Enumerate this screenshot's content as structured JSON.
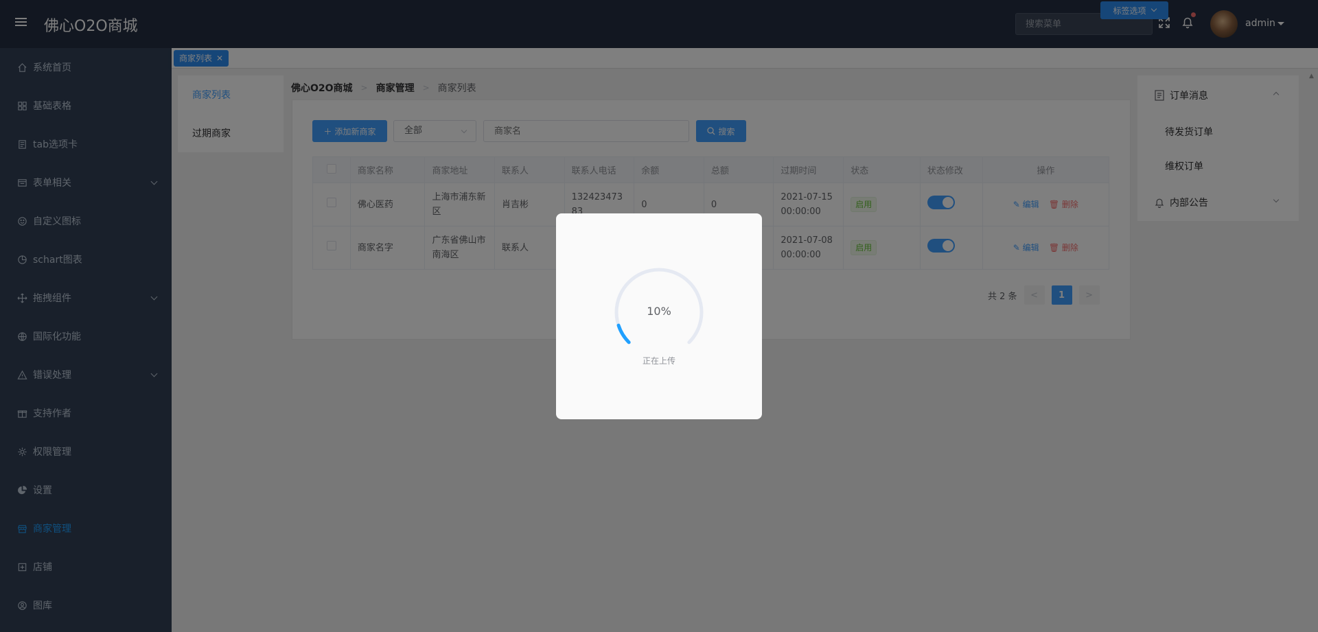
{
  "header": {
    "logo": "佛心O2O商城",
    "search_placeholder": "搜索菜单",
    "user_name": "admin"
  },
  "sidebar": {
    "items": [
      {
        "label": "系统首页",
        "icon": "home-icon"
      },
      {
        "label": "基础表格",
        "icon": "grid-icon"
      },
      {
        "label": "tab选项卡",
        "icon": "document-icon"
      },
      {
        "label": "表单相关",
        "icon": "form-icon"
      },
      {
        "label": "自定义图标",
        "icon": "smile-icon"
      },
      {
        "label": "schart图表",
        "icon": "pie-chart-icon"
      },
      {
        "label": "拖拽组件",
        "icon": "drag-icon"
      },
      {
        "label": "国际化功能",
        "icon": "globe-icon"
      },
      {
        "label": "错误处理",
        "icon": "warning-icon"
      },
      {
        "label": "支持作者",
        "icon": "gift-icon"
      },
      {
        "label": "权限管理",
        "icon": "gear-icon"
      },
      {
        "label": "设置",
        "icon": "pie-icon"
      },
      {
        "label": "商家管理",
        "icon": "shop-icon"
      },
      {
        "label": "店铺",
        "icon": "store-icon"
      },
      {
        "label": "图库",
        "icon": "gallery-icon"
      }
    ]
  },
  "tags": {
    "active_tag": "商家列表",
    "options_label": "标签选项"
  },
  "left_menu": {
    "items": [
      "商家列表",
      "过期商家"
    ]
  },
  "breadcrumb": {
    "root": "佛心O2O商城",
    "parent": "商家管理",
    "current": "商家列表"
  },
  "toolbar": {
    "add_label": "添加新商家",
    "select_value": "全部",
    "name_placeholder": "商家名",
    "search_label": "搜索"
  },
  "table": {
    "headers": [
      "商家名称",
      "商家地址",
      "联系人",
      "联系人电话",
      "余额",
      "总额",
      "过期时间",
      "状态",
      "状态修改",
      "操作"
    ],
    "rows": [
      {
        "name": "佛心医药",
        "address": "上海市浦东新区",
        "contact": "肖吉彬",
        "phone": "13242347383",
        "balance": "0",
        "total": "0",
        "expire": "2021-07-15 00:00:00",
        "status": "启用"
      },
      {
        "name": "商家名字",
        "address": "广东省佛山市南海区",
        "contact": "联系人",
        "phone": "",
        "balance": "",
        "total": "",
        "expire": "2021-07-08 00:00:00",
        "status": "启用"
      }
    ],
    "edit_label": "编辑",
    "delete_label": "删除"
  },
  "pagination": {
    "total_text": "共 2 条",
    "current_page": "1"
  },
  "right_panel": {
    "group1": "订单消息",
    "group1_items": [
      "待发货订单",
      "维权订单"
    ],
    "group2": "内部公告"
  },
  "modal": {
    "progress_percent": 10,
    "progress_text": "10%",
    "status_label": "正在上传"
  },
  "colors": {
    "header_bg": "#242f42",
    "sidebar_bg": "#324157",
    "accent": "#409eff",
    "danger": "#f56c6c",
    "success": "#67c23a"
  }
}
